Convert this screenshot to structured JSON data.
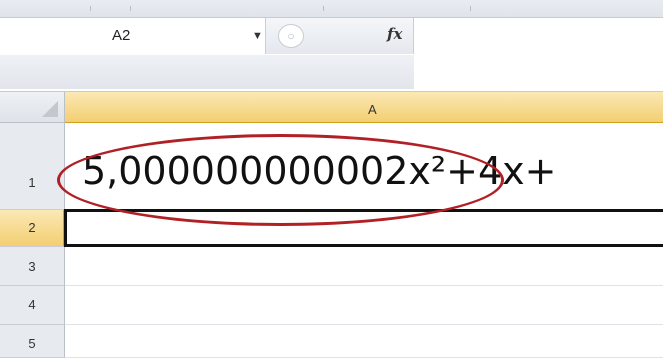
{
  "namebox": {
    "value": "A2",
    "dropdown_icon": "chevron-down-icon"
  },
  "formula_bar": {
    "fx_label": "fx",
    "cancel_icon": "circle-icon",
    "content": ""
  },
  "grid": {
    "column_header": "A",
    "rows": [
      {
        "number": "1",
        "value": "5,000000000002x²+4x+"
      },
      {
        "number": "2",
        "value": ""
      },
      {
        "number": "3",
        "value": ""
      },
      {
        "number": "4",
        "value": ""
      },
      {
        "number": "5",
        "value": ""
      }
    ],
    "active_cell": "A2"
  },
  "annotation": {
    "color": "#b02025"
  }
}
